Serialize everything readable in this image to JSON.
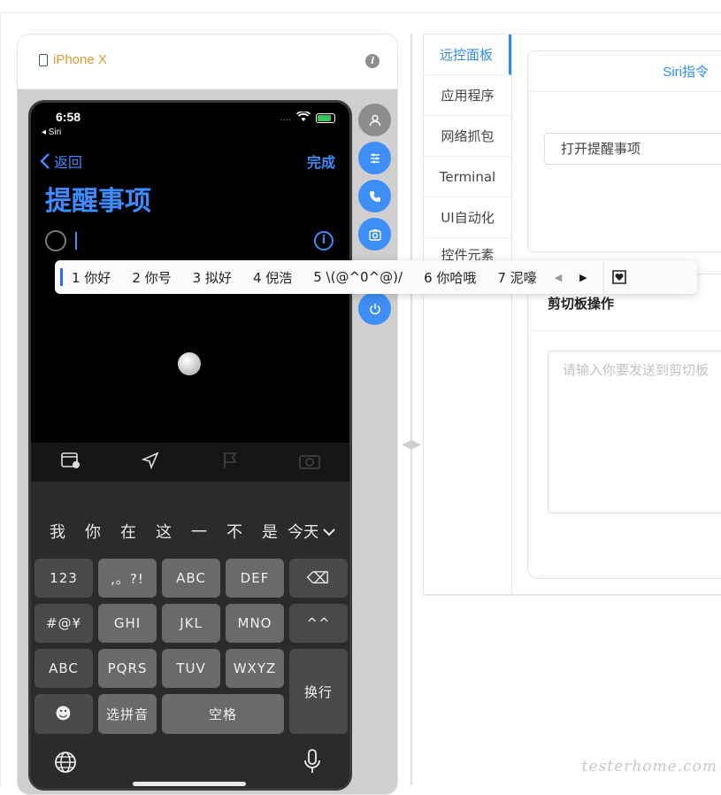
{
  "device": {
    "title": "iPhone X",
    "info_icon": "i"
  },
  "phone": {
    "time": "6:58",
    "back_app": "◂ Siri",
    "status_dots": "....",
    "nav": {
      "back_label": "返回",
      "done_label": "完成"
    },
    "list_title": "提醒事项",
    "info_symbol": "i",
    "toolbar_icons": [
      "calendar-clock-icon",
      "location-arrow-icon",
      "flag-icon",
      "camera-icon"
    ],
    "candidates": [
      "我",
      "你",
      "在",
      "这",
      "一",
      "不",
      "是",
      "今天"
    ],
    "keyboard": {
      "rows": [
        [
          "123",
          ",。?!",
          "ABC",
          "DEF",
          "⌫"
        ],
        [
          "#@¥",
          "GHI",
          "JKL",
          "MNO",
          "^^"
        ],
        [
          "ABC",
          "PQRS",
          "TUV",
          "WXYZ",
          "换行"
        ],
        [
          "☻",
          "选拼音",
          "空格"
        ]
      ]
    }
  },
  "side_buttons": [
    "person-icon",
    "settings-sliders-icon",
    "phone-icon",
    "screenshot-icon",
    "power-icon"
  ],
  "ime": {
    "candidates": [
      "1 你好",
      "2 你号",
      "3 拟好",
      "4 倪浩",
      "5 \\(@^0^@)/",
      "6 你哈哦",
      "7 泥嚎"
    ],
    "prev": "◀",
    "next": "▶"
  },
  "tabs": [
    "远控面板",
    "应用程序",
    "网络抓包",
    "Terminal",
    "UI自动化",
    "控件元素"
  ],
  "siri": {
    "title": "Siri指令",
    "input_value": "打开提醒事项"
  },
  "clipboard": {
    "title": "剪切板操作",
    "placeholder": "请输入你要发送到剪切板"
  },
  "watermark": "testerhome.com",
  "colors": {
    "accent": "#2d8cf0",
    "ios_blue": "#3d8cff",
    "device_title": "#e0982f",
    "side_button": "#3d8ef7"
  }
}
